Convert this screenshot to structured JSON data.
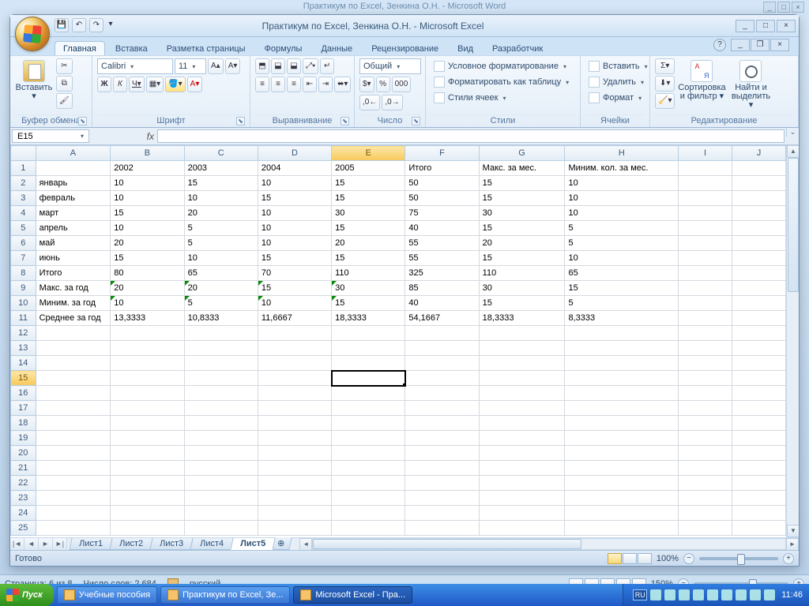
{
  "word": {
    "title": "Практикум по Excel, Зенкина О.Н. - Microsoft Word",
    "status": {
      "page": "Страница: 6 из 8",
      "words": "Число слов: 2 684",
      "lang": "русский",
      "zoom": "150%"
    }
  },
  "excel": {
    "title": "Практикум по Excel, Зенкина О.Н. - Microsoft Excel",
    "tabs": [
      "Главная",
      "Вставка",
      "Разметка страницы",
      "Формулы",
      "Данные",
      "Рецензирование",
      "Вид",
      "Разработчик"
    ],
    "active_tab": 0,
    "ribbon": {
      "clipboard": {
        "paste": "Вставить",
        "label": "Буфер обмена"
      },
      "font": {
        "name": "Calibri",
        "size": "11",
        "label": "Шрифт",
        "bold": "Ж",
        "italic": "К",
        "underline": "Ч"
      },
      "alignment": {
        "label": "Выравнивание"
      },
      "number": {
        "format": "Общий",
        "label": "Число"
      },
      "styles": {
        "conditional": "Условное форматирование",
        "as_table": "Форматировать как таблицу",
        "cell_styles": "Стили ячеек",
        "label": "Стили"
      },
      "cells": {
        "insert": "Вставить",
        "delete": "Удалить",
        "format": "Формат",
        "label": "Ячейки"
      },
      "editing": {
        "sort": "Сортировка и фильтр",
        "find": "Найти и выделить",
        "label": "Редактирование"
      }
    },
    "namebox": "E15",
    "columns": [
      "A",
      "B",
      "C",
      "D",
      "E",
      "F",
      "G",
      "H",
      "I",
      "J"
    ],
    "rows": [
      {
        "n": 1,
        "cells": [
          "",
          "2002",
          "2003",
          "2004",
          "2005",
          "Итого",
          "Макс. за мес.",
          "Миним. кол. за мес.",
          "",
          ""
        ]
      },
      {
        "n": 2,
        "cells": [
          "январь",
          "10",
          "15",
          "10",
          "15",
          "50",
          "15",
          "10",
          "",
          ""
        ]
      },
      {
        "n": 3,
        "cells": [
          "февраль",
          "10",
          "10",
          "15",
          "15",
          "50",
          "15",
          "10",
          "",
          ""
        ]
      },
      {
        "n": 4,
        "cells": [
          "март",
          "15",
          "20",
          "10",
          "30",
          "75",
          "30",
          "10",
          "",
          ""
        ]
      },
      {
        "n": 5,
        "cells": [
          "апрель",
          "10",
          "5",
          "10",
          "15",
          "40",
          "15",
          "5",
          "",
          ""
        ]
      },
      {
        "n": 6,
        "cells": [
          "май",
          "20",
          "5",
          "10",
          "20",
          "55",
          "20",
          "5",
          "",
          ""
        ]
      },
      {
        "n": 7,
        "cells": [
          "июнь",
          "15",
          "10",
          "15",
          "15",
          "55",
          "15",
          "10",
          "",
          ""
        ]
      },
      {
        "n": 8,
        "cells": [
          "Итого",
          "80",
          "65",
          "70",
          "110",
          "325",
          "110",
          "65",
          "",
          ""
        ]
      },
      {
        "n": 9,
        "cells": [
          "Макс. за год",
          "20",
          "20",
          "15",
          "30",
          "85",
          "30",
          "15",
          "",
          ""
        ],
        "tri": [
          1,
          2,
          3,
          4
        ]
      },
      {
        "n": 10,
        "cells": [
          "Миним. за год",
          "10",
          "5",
          "10",
          "15",
          "40",
          "15",
          "5",
          "",
          ""
        ],
        "tri": [
          1,
          2,
          3,
          4
        ]
      },
      {
        "n": 11,
        "cells": [
          "Среднее за год",
          "13,3333",
          "10,8333",
          "11,6667",
          "18,3333",
          "54,1667",
          "18,3333",
          "8,3333",
          "",
          ""
        ]
      },
      {
        "n": 12,
        "cells": [
          "",
          "",
          "",
          "",
          "",
          "",
          "",
          "",
          "",
          ""
        ]
      },
      {
        "n": 13,
        "cells": [
          "",
          "",
          "",
          "",
          "",
          "",
          "",
          "",
          "",
          ""
        ]
      },
      {
        "n": 14,
        "cells": [
          "",
          "",
          "",
          "",
          "",
          "",
          "",
          "",
          "",
          ""
        ]
      },
      {
        "n": 15,
        "cells": [
          "",
          "",
          "",
          "",
          "",
          "",
          "",
          "",
          "",
          ""
        ]
      },
      {
        "n": 16,
        "cells": [
          "",
          "",
          "",
          "",
          "",
          "",
          "",
          "",
          "",
          ""
        ]
      },
      {
        "n": 17,
        "cells": [
          "",
          "",
          "",
          "",
          "",
          "",
          "",
          "",
          "",
          ""
        ]
      },
      {
        "n": 18,
        "cells": [
          "",
          "",
          "",
          "",
          "",
          "",
          "",
          "",
          "",
          ""
        ]
      },
      {
        "n": 19,
        "cells": [
          "",
          "",
          "",
          "",
          "",
          "",
          "",
          "",
          "",
          ""
        ]
      },
      {
        "n": 20,
        "cells": [
          "",
          "",
          "",
          "",
          "",
          "",
          "",
          "",
          "",
          ""
        ]
      },
      {
        "n": 21,
        "cells": [
          "",
          "",
          "",
          "",
          "",
          "",
          "",
          "",
          "",
          ""
        ]
      },
      {
        "n": 22,
        "cells": [
          "",
          "",
          "",
          "",
          "",
          "",
          "",
          "",
          "",
          ""
        ]
      },
      {
        "n": 23,
        "cells": [
          "",
          "",
          "",
          "",
          "",
          "",
          "",
          "",
          "",
          ""
        ]
      },
      {
        "n": 24,
        "cells": [
          "",
          "",
          "",
          "",
          "",
          "",
          "",
          "",
          "",
          ""
        ]
      },
      {
        "n": 25,
        "cells": [
          "",
          "",
          "",
          "",
          "",
          "",
          "",
          "",
          "",
          ""
        ]
      }
    ],
    "active_cell": {
      "row": 15,
      "col": 4
    },
    "sheet_tabs": [
      "Лист1",
      "Лист2",
      "Лист3",
      "Лист4",
      "Лист5"
    ],
    "active_sheet": 4,
    "status": {
      "ready": "Готово",
      "zoom": "100%"
    }
  },
  "taskbar": {
    "start": "Пуск",
    "buttons": [
      {
        "label": "Учебные пособия"
      },
      {
        "label": "Практикум по Excel, Зе..."
      },
      {
        "label": "Microsoft Excel - Пра...",
        "active": true
      }
    ],
    "lang": "RU",
    "clock": "11:46"
  }
}
